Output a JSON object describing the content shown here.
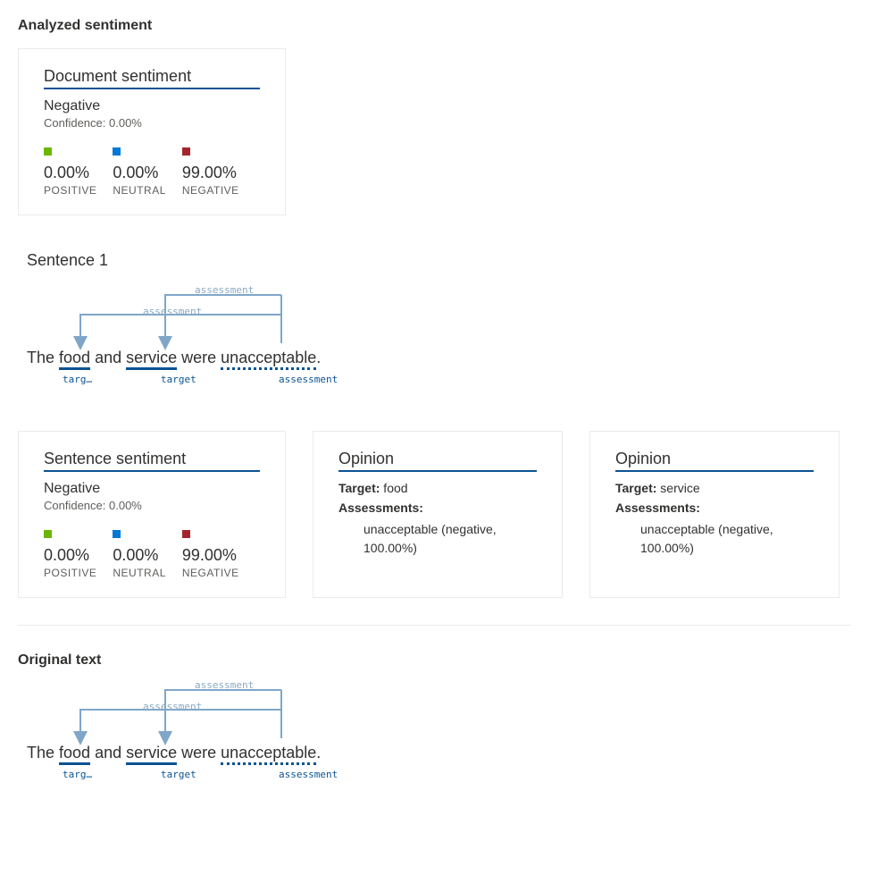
{
  "sections": {
    "analyzed": "Analyzed sentiment",
    "original": "Original text"
  },
  "doc_card": {
    "title": "Document sentiment",
    "verdict": "Negative",
    "confidence": "Confidence: 0.00%",
    "scores": {
      "positive": {
        "value": "0.00%",
        "label": "POSITIVE"
      },
      "neutral": {
        "value": "0.00%",
        "label": "NEUTRAL"
      },
      "negative": {
        "value": "99.00%",
        "label": "NEGATIVE"
      }
    }
  },
  "sentence_heading": "Sentence 1",
  "diagram": {
    "tokens": {
      "t0": "The ",
      "t1": "food",
      "t2": " and ",
      "t3": "service",
      "t4": " were ",
      "t5": "unacceptable",
      "t6": "."
    },
    "labels": {
      "food": "targ…",
      "service": "target",
      "assess": "assessment"
    },
    "arrow_labels": {
      "a1": "assessment",
      "a2": "assessment"
    }
  },
  "sent_card": {
    "title": "Sentence sentiment",
    "verdict": "Negative",
    "confidence": "Confidence: 0.00%",
    "scores": {
      "positive": {
        "value": "0.00%",
        "label": "POSITIVE"
      },
      "neutral": {
        "value": "0.00%",
        "label": "NEUTRAL"
      },
      "negative": {
        "value": "99.00%",
        "label": "NEGATIVE"
      }
    }
  },
  "opinion1": {
    "title": "Opinion",
    "target_label": "Target:",
    "target_value": " food",
    "assess_label": "Assessments:",
    "assess_value": "unacceptable (negative, 100.00%)"
  },
  "opinion2": {
    "title": "Opinion",
    "target_label": "Target:",
    "target_value": " service",
    "assess_label": "Assessments:",
    "assess_value": "unacceptable (negative, 100.00%)"
  }
}
